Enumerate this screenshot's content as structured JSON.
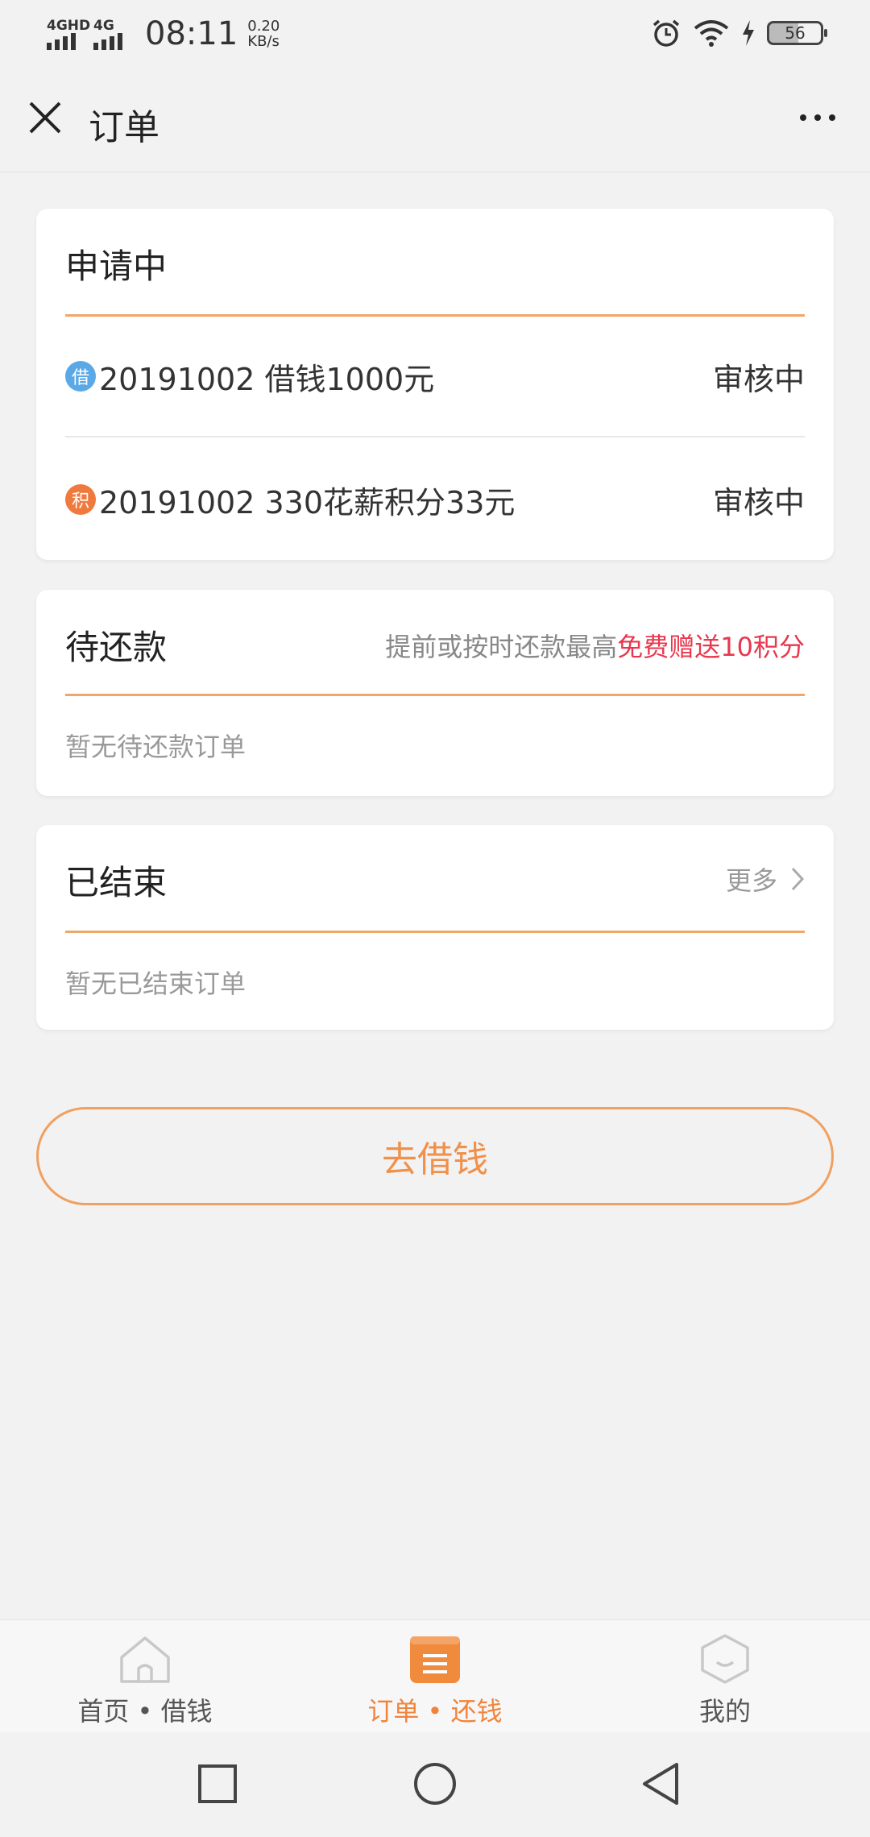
{
  "status_bar": {
    "signal1_label": "4GHD",
    "signal2_label": "4G",
    "time": "08:11",
    "speed_value": "0.20",
    "speed_unit": "KB/s",
    "battery": "56"
  },
  "header": {
    "title": "订单"
  },
  "applying": {
    "title": "申请中",
    "rows": [
      {
        "badge": "借",
        "badge_color": "#5aa9e6",
        "text": "20191002 借钱1000元",
        "status": "审核中"
      },
      {
        "badge": "积",
        "badge_color": "#f07a3e",
        "text": "20191002 330花薪积分33元",
        "status": "审核中"
      }
    ]
  },
  "pending": {
    "title": "待还款",
    "hint_prefix": "提前或按时还款最高",
    "hint_highlight": "免费赠送10积分",
    "empty": "暂无待还款订单"
  },
  "finished": {
    "title": "已结束",
    "more": "更多",
    "empty": "暂无已结束订单"
  },
  "borrow_button": "去借钱",
  "tabs": [
    {
      "label": "首页 • 借钱",
      "icon": "home-icon"
    },
    {
      "label": "订单 • 还钱",
      "icon": "order-icon",
      "active": true
    },
    {
      "label": "我的",
      "icon": "smile-icon"
    }
  ],
  "colors": {
    "accent": "#f0843c",
    "highlight": "#e8374e"
  }
}
